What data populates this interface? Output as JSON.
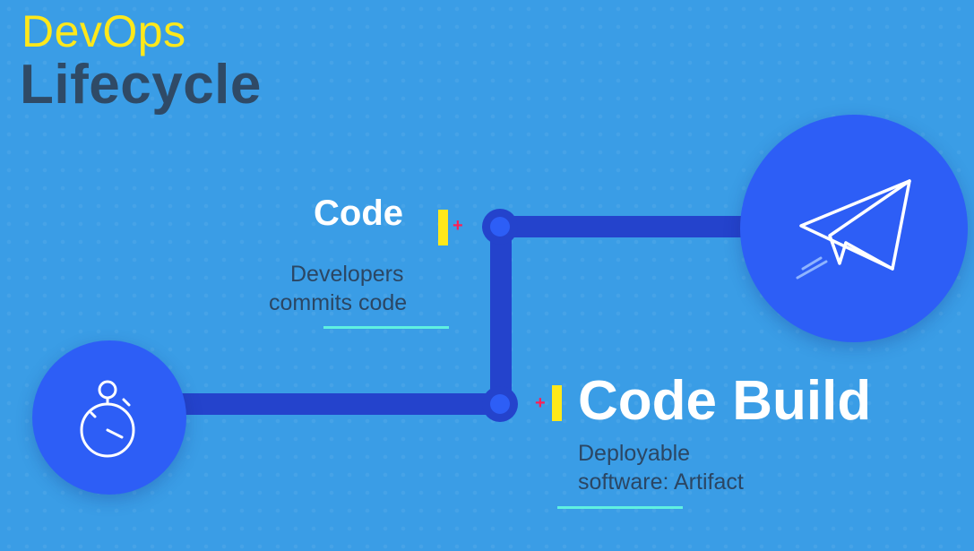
{
  "title": {
    "line1": "DevOps",
    "line2": "Lifecycle"
  },
  "steps": [
    {
      "heading": "Code",
      "description_lines": [
        "Developers",
        "commits code"
      ]
    },
    {
      "heading": "Code Build",
      "description_lines": [
        "Deployable",
        "software: Artifact"
      ]
    }
  ],
  "icons": {
    "start": "stopwatch-icon",
    "end": "paper-plane-icon",
    "marker": "plus-icon"
  },
  "markers": {
    "plus_symbol": "+"
  },
  "colors": {
    "background": "#3a9de6",
    "connector": "#2443cc",
    "circle": "#2d5ef6",
    "title_accent": "#ffe81a",
    "title_dark": "#2f4a66",
    "marker_bar": "#ffe81a",
    "marker_plus": "#ff1f55",
    "underline": "#5ff0e0"
  }
}
